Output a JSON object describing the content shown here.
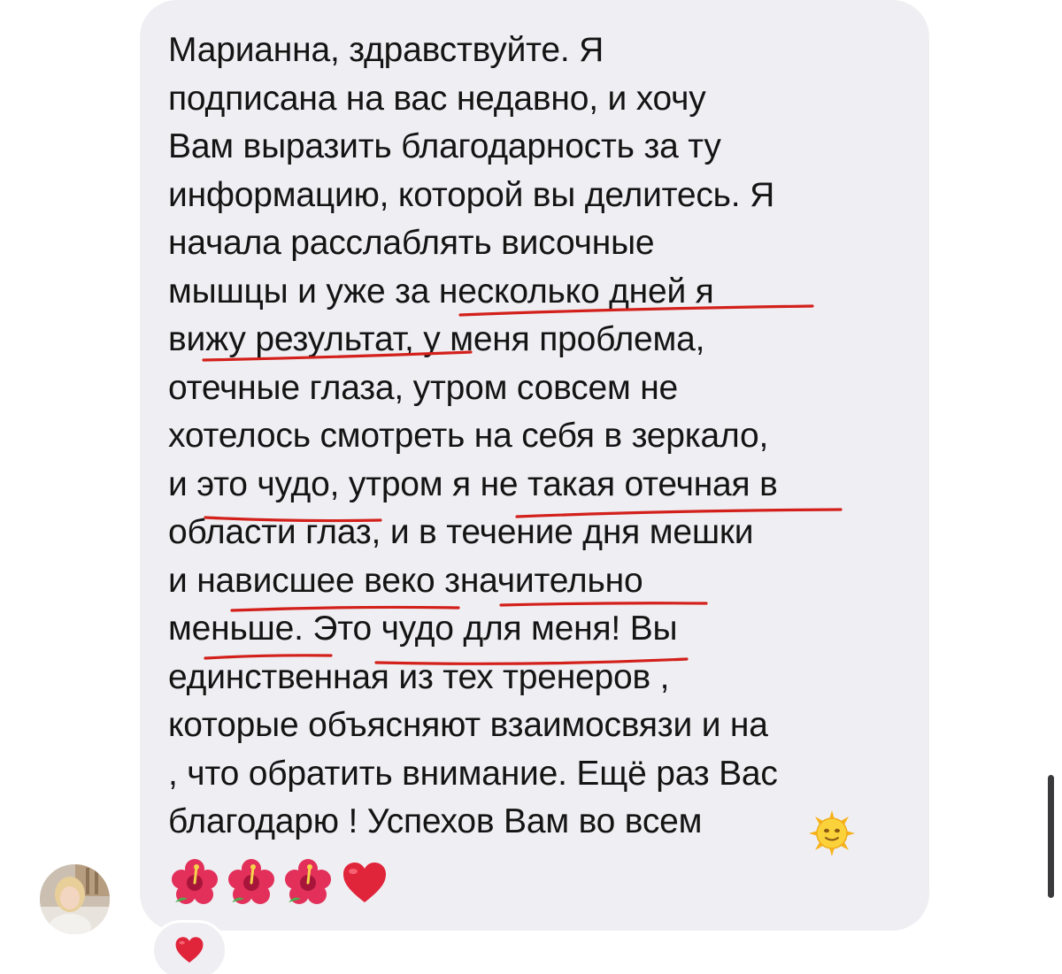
{
  "message": {
    "lines": [
      "Марианна, здравствуйте. Я",
      "подписана на вас недавно, и хочу",
      "Вам выразить благодарность за ту",
      "информацию, которой вы делитесь. Я",
      "начала расслаблять височные",
      "мышцы и уже за несколько дней я",
      "вижу результат, у меня проблема,",
      "отечные глаза, утром совсем не",
      "хотелось смотреть на себя в зеркало,",
      "и это чудо, утром я не такая отечная в",
      "области глаз, и в течение дня мешки",
      "и нависшее веко значительно",
      "меньше. Это чудо для меня! Вы",
      "единственная из тех тренеров ,",
      "которые объясняют взаимосвязи и на",
      ", что обратить внимание. Ещё раз Вас",
      "благодарю ! Успехов Вам во всем"
    ],
    "trailing_emoji": "sun-with-face",
    "emoji_row": [
      "hibiscus",
      "hibiscus",
      "hibiscus",
      "red-heart"
    ]
  },
  "reaction": {
    "emoji": "red-heart"
  },
  "colors": {
    "bubble": "#efeff3",
    "text": "#141414",
    "underline": "#d3201b",
    "heart": "#e0243a",
    "scrollbar": "#3a3a3c"
  }
}
